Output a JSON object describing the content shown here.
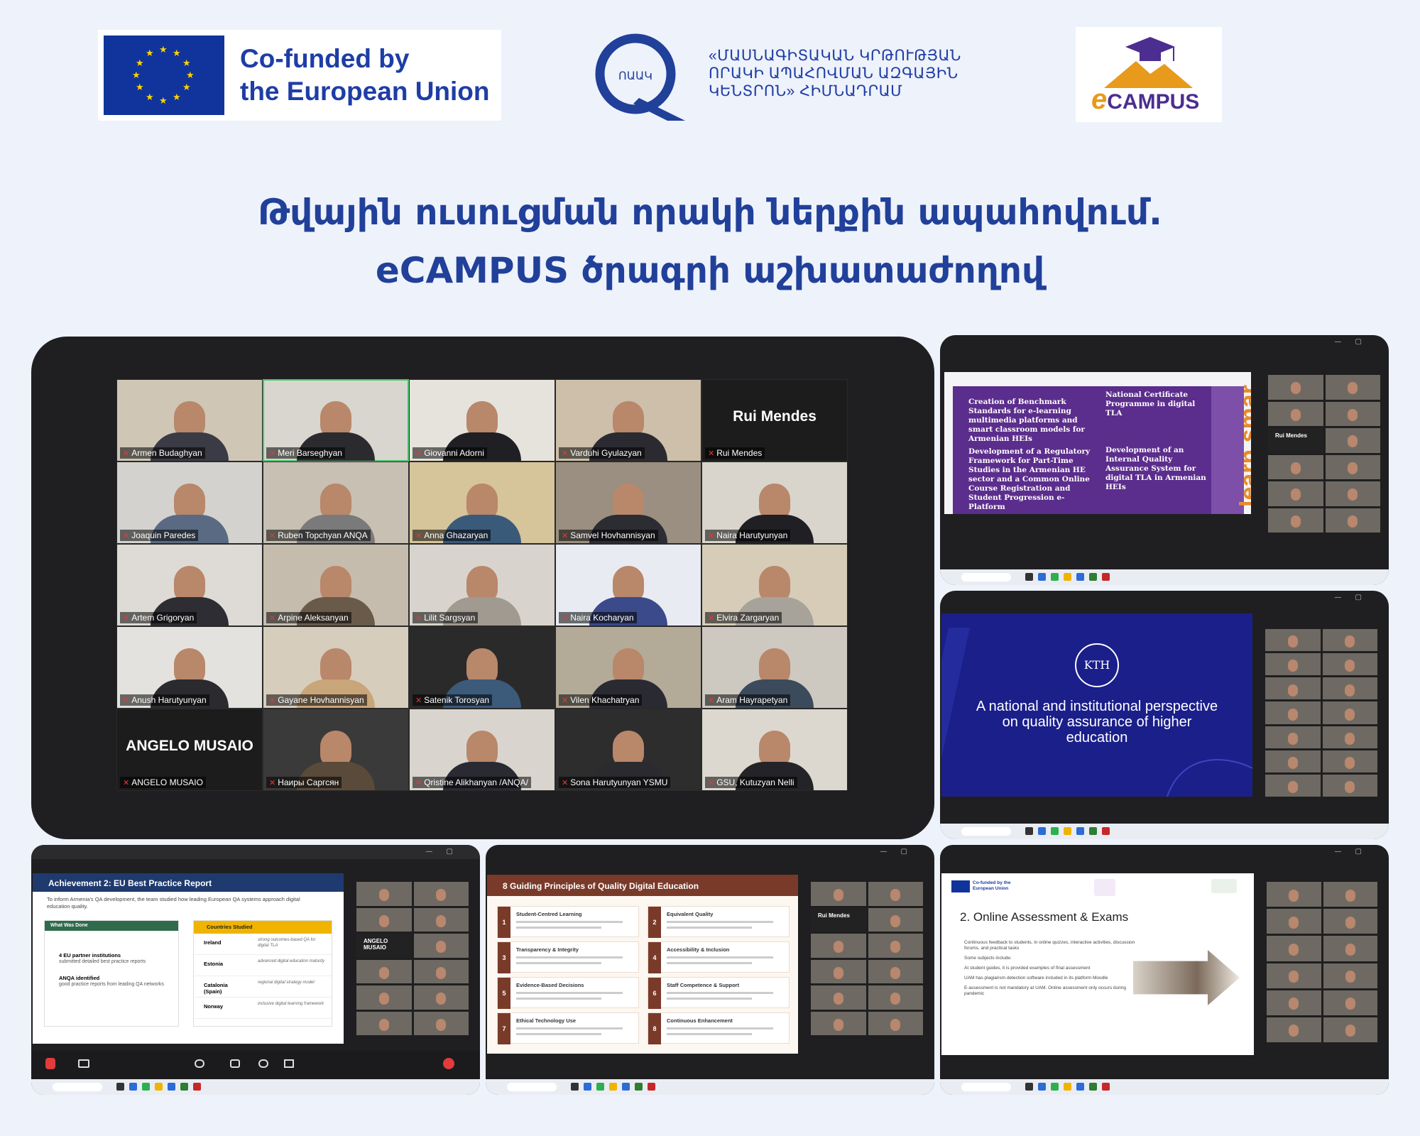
{
  "header": {
    "eu_line1": "Co-funded by",
    "eu_line2": "the European Union",
    "anqa_abbr": "ՈԱԱԿ",
    "anqa_line1": "«ՄԱՍՆԱԳԻՏԱԿԱՆ ԿՐԹՈՒԹՅԱՆ",
    "anqa_line2": "ՈՐԱԿԻ ԱՊԱՀՈՎՄԱՆ ԱԶԳԱՅԻՆ",
    "anqa_line3": "ԿԵՆՏՐՈՆ» ՀԻՄՆԱԴՐԱՄ",
    "ecampus_brand": "CAMPUS",
    "ecampus_e": "e"
  },
  "heading": {
    "line1": "Թվային ուսուցման որակի ներքին ապահովում.",
    "line2": "eCAMPUS ծրագրի աշխատաժողով"
  },
  "zoom_grid": [
    {
      "name": "Armen Budaghyan",
      "shirt": "#3b3b46",
      "bg": "#cfc6b5"
    },
    {
      "name": "Meri Barseghyan",
      "shirt": "#2b2b2f",
      "bg": "#d9d5cf",
      "active": true
    },
    {
      "name": "Giovanni Adorni",
      "shirt": "#1f1f24",
      "bg": "#e6e3dc"
    },
    {
      "name": "Varduhi Gyulazyan",
      "shirt": "#2a2a30",
      "bg": "#cdbfa9"
    },
    {
      "name": "Rui Mendes",
      "dark": true,
      "big": "Rui Mendes"
    },
    {
      "name": "Joaquin Paredes",
      "shirt": "#5a6a82",
      "bg": "#d4d2cf"
    },
    {
      "name": "Ruben Topchyan ANQA",
      "shirt": "#7a7a7a",
      "bg": "#c7c0b3"
    },
    {
      "name": "Anna Ghazaryan",
      "shirt": "#3a5a7a",
      "bg": "#d6c49a"
    },
    {
      "name": "Samvel Hovhannisyan",
      "shirt": "#2c2c33",
      "bg": "#9a8f80"
    },
    {
      "name": "Naira Harutyunyan",
      "shirt": "#1f1f24",
      "bg": "#d9d4cc"
    },
    {
      "name": "Artem Grigoryan",
      "shirt": "#2d2d33",
      "bg": "#dedbd6"
    },
    {
      "name": "Arpine Aleksanyan",
      "shirt": "#6a5a4a",
      "bg": "#c5bcad"
    },
    {
      "name": "Lilit Sargsyan",
      "shirt": "#a09a90",
      "bg": "#d8d4cd"
    },
    {
      "name": "Naira Kocharyan",
      "shirt": "#3a4a8a",
      "bg": "#e8ecf2"
    },
    {
      "name": "Elvira Zargaryan",
      "shirt": "#a8a39a",
      "bg": "#d6ccb8"
    },
    {
      "name": "Anush Harutyunyan",
      "shirt": "#2a2a2f",
      "bg": "#e4e2de"
    },
    {
      "name": "Gayane Hovhannisyan",
      "shirt": "#c9a57a",
      "bg": "#d7cdbd"
    },
    {
      "name": "Satenik Torosyan",
      "shirt": "#3c5a7a",
      "bg": "#2a2a2a"
    },
    {
      "name": "Vilen Khachatryan",
      "shirt": "#2a2a33",
      "bg": "#b4aa98"
    },
    {
      "name": "Aram Hayrapetyan",
      "shirt": "#3b4b5b",
      "bg": "#cdc9c1"
    },
    {
      "name": "ANGELO MUSAIO",
      "dark": true,
      "big": "ANGELO MUSAIO"
    },
    {
      "name": "Наиры Саргсян",
      "shirt": "#5a4a3a",
      "bg": "#3a3a3a"
    },
    {
      "name": "Qristine Alikhanyan /ANQA/",
      "shirt": "#2a2a33",
      "bg": "#d9d5ce"
    },
    {
      "name": "Sona Harutyunyan YSMU",
      "shirt": "#2a2a2f",
      "bg": "#2d2d2d"
    },
    {
      "name": "GSU, Kutuzyan Nelli",
      "shirt": "#242428",
      "bg": "#dcd8d0"
    }
  ],
  "slide_tr1": {
    "left_1": "Creation of Benchmark Standards for e-learning multimedia platforms and smart classroom models for Armenian HEIs",
    "left_2": "Development of a Regulatory Framework for Part-Time Studies in the Armenian HE sector and a Common Online Course Registration and Student Progression e-Platform",
    "right_1": "National Certificate Programme in digital TLA",
    "right_2": "Development of an Internal Quality Assurance System for digital TLA in Armenian HEIs",
    "side_text": "learn smar",
    "side_label": "Rui Mendes"
  },
  "slide_tr2": {
    "badge": "KTH",
    "title": "A national and institutional perspective on quality assurance of higher education"
  },
  "slide_b1": {
    "title": "Achievement 2: EU Best Practice Report",
    "intro": "To inform Armenia's QA development, the team studied how leading European QA systems approach digital education quality.",
    "left_header": "What Was Done",
    "left_1_title": "4 EU partner institutions",
    "left_1_text": "submitted detailed best practice reports",
    "left_2_title": "ANQA identified",
    "left_2_text": "good practice reports from leading QA networks",
    "right_header": "Countries Studied",
    "countries": [
      {
        "name": "Ireland",
        "note": "strong outcomes-based QA for digital TLA"
      },
      {
        "name": "Estonia",
        "note": "advanced digital education maturity"
      },
      {
        "name": "Catalonia (Spain)",
        "note": "regional digital strategy model"
      },
      {
        "name": "Norway",
        "note": "inclusive digital learning framework"
      }
    ],
    "side_label": "ANGELO MUSAIO"
  },
  "slide_b2": {
    "title": "8 Guiding Principles of Quality Digital Education",
    "principles": [
      {
        "n": "1",
        "t": "Student-Centred Learning"
      },
      {
        "n": "2",
        "t": "Equivalent Quality"
      },
      {
        "n": "3",
        "t": "Transparency & Integrity"
      },
      {
        "n": "4",
        "t": "Accessibility & Inclusion"
      },
      {
        "n": "5",
        "t": "Evidence-Based Decisions"
      },
      {
        "n": "6",
        "t": "Staff Competence & Support"
      },
      {
        "n": "7",
        "t": "Ethical Technology Use"
      },
      {
        "n": "8",
        "t": "Continuous Enhancement"
      }
    ],
    "side_label": "Rui Mendes"
  },
  "slide_b3": {
    "eu_small": "Co-funded by the European Union",
    "title": "2. Online Assessment & Exams",
    "bullets": [
      "Continuous feedback to students, in online quizzes, interactive activities, discussion forums, and practical tasks",
      "Some subjects include:",
      "At student guides, it is provided examples of final assessment",
      "UAM has plagiarism detection software included in its platform Moodle",
      "E-assessment is not mandatory at UAM. Online assessment only occurs during pandemic"
    ]
  },
  "colors": {
    "brand_blue": "#21409a",
    "eu_flag": "#10349b",
    "eu_star": "#ffd400",
    "slide_purple": "#5b2d8c",
    "slide_orange": "#e88b2a",
    "kth_blue": "#1b1f8a",
    "mic_muted": "#e23b3b",
    "active_speaker": "#49c46a"
  }
}
